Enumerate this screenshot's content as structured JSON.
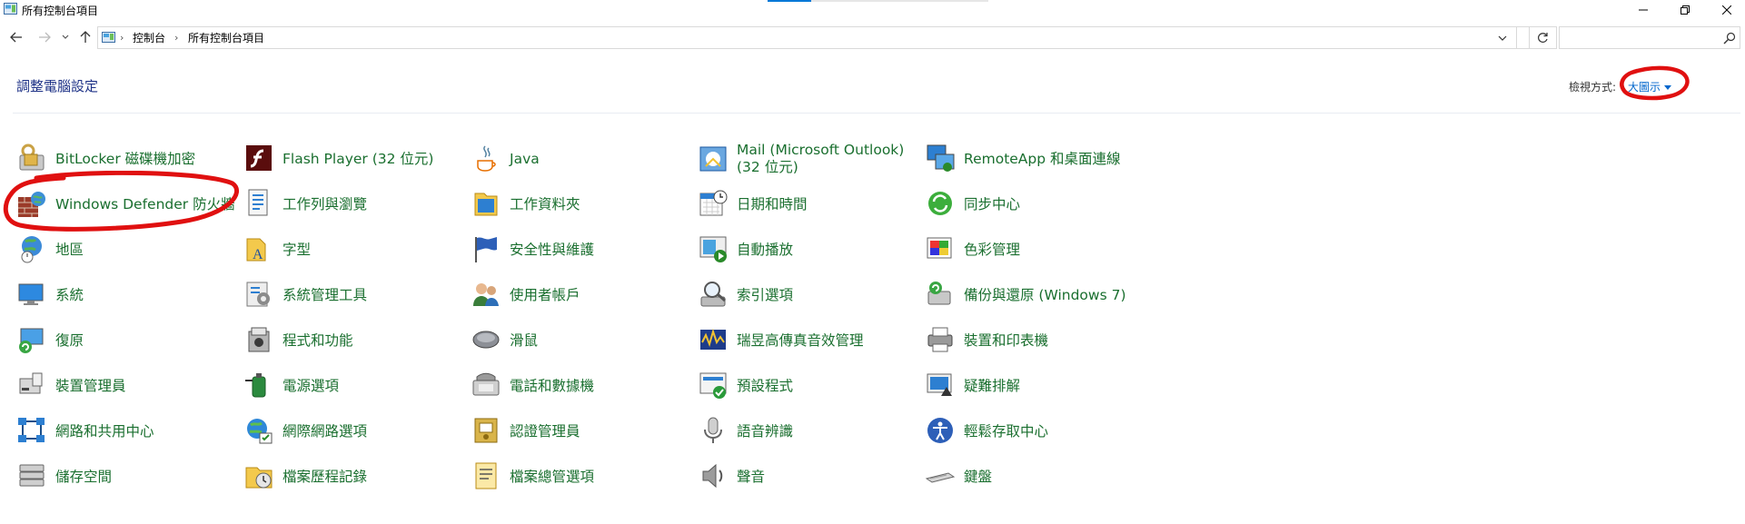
{
  "window": {
    "title": "所有控制台項目"
  },
  "address": {
    "crumbs": [
      "控制台",
      "所有控制台項目"
    ],
    "search_placeholder": ""
  },
  "header": {
    "title": "調整電腦設定",
    "view_by_label": "檢視方式:",
    "view_by_value": "大圖示"
  },
  "items": [
    {
      "label": "BitLocker 磁碟機加密",
      "icon": "bitlocker-icon"
    },
    {
      "label": "Windows Defender 防火牆",
      "icon": "firewall-icon"
    },
    {
      "label": "地區",
      "icon": "region-icon"
    },
    {
      "label": "系統",
      "icon": "system-icon"
    },
    {
      "label": "復原",
      "icon": "recovery-icon"
    },
    {
      "label": "裝置管理員",
      "icon": "device-manager-icon"
    },
    {
      "label": "網路和共用中心",
      "icon": "network-icon"
    },
    {
      "label": "儲存空間",
      "icon": "storage-icon"
    },
    {
      "label": "Flash Player (32 位元)",
      "icon": "flash-icon"
    },
    {
      "label": "工作列與瀏覽",
      "icon": "taskbar-icon"
    },
    {
      "label": "字型",
      "icon": "fonts-icon"
    },
    {
      "label": "系統管理工具",
      "icon": "admin-tools-icon"
    },
    {
      "label": "程式和功能",
      "icon": "programs-icon"
    },
    {
      "label": "電源選項",
      "icon": "power-icon"
    },
    {
      "label": "網際網路選項",
      "icon": "internet-options-icon"
    },
    {
      "label": "檔案歷程記錄",
      "icon": "file-history-icon"
    },
    {
      "label": "Java",
      "icon": "java-icon"
    },
    {
      "label": "工作資料夾",
      "icon": "work-folders-icon"
    },
    {
      "label": "安全性與維護",
      "icon": "security-flag-icon"
    },
    {
      "label": "使用者帳戶",
      "icon": "user-accounts-icon"
    },
    {
      "label": "滑鼠",
      "icon": "mouse-icon"
    },
    {
      "label": "電話和數據機",
      "icon": "phone-modem-icon"
    },
    {
      "label": "認證管理員",
      "icon": "credential-icon"
    },
    {
      "label": "檔案總管選項",
      "icon": "explorer-options-icon"
    },
    {
      "label": "Mail (Microsoft Outlook) (32 位元)",
      "icon": "mail-icon"
    },
    {
      "label": "日期和時間",
      "icon": "datetime-icon"
    },
    {
      "label": "自動播放",
      "icon": "autoplay-icon"
    },
    {
      "label": "索引選項",
      "icon": "indexing-icon"
    },
    {
      "label": "瑞昱高傳真音效管理",
      "icon": "realtek-audio-icon"
    },
    {
      "label": "預設程式",
      "icon": "default-programs-icon"
    },
    {
      "label": "語音辨識",
      "icon": "speech-icon"
    },
    {
      "label": "聲音",
      "icon": "sound-icon"
    },
    {
      "label": "RemoteApp 和桌面連線",
      "icon": "remoteapp-icon"
    },
    {
      "label": "同步中心",
      "icon": "sync-icon"
    },
    {
      "label": "色彩管理",
      "icon": "color-management-icon"
    },
    {
      "label": "備份與還原 (Windows 7)",
      "icon": "backup-icon"
    },
    {
      "label": "裝置和印表機",
      "icon": "printer-icon"
    },
    {
      "label": "疑難排解",
      "icon": "troubleshoot-icon"
    },
    {
      "label": "輕鬆存取中心",
      "icon": "ease-of-access-icon"
    },
    {
      "label": "鍵盤",
      "icon": "keyboard-icon"
    }
  ],
  "colors": {
    "item_label": "#1a6f2f",
    "title": "#1e3287",
    "link": "#0066cc",
    "annotation": "#e01010"
  }
}
